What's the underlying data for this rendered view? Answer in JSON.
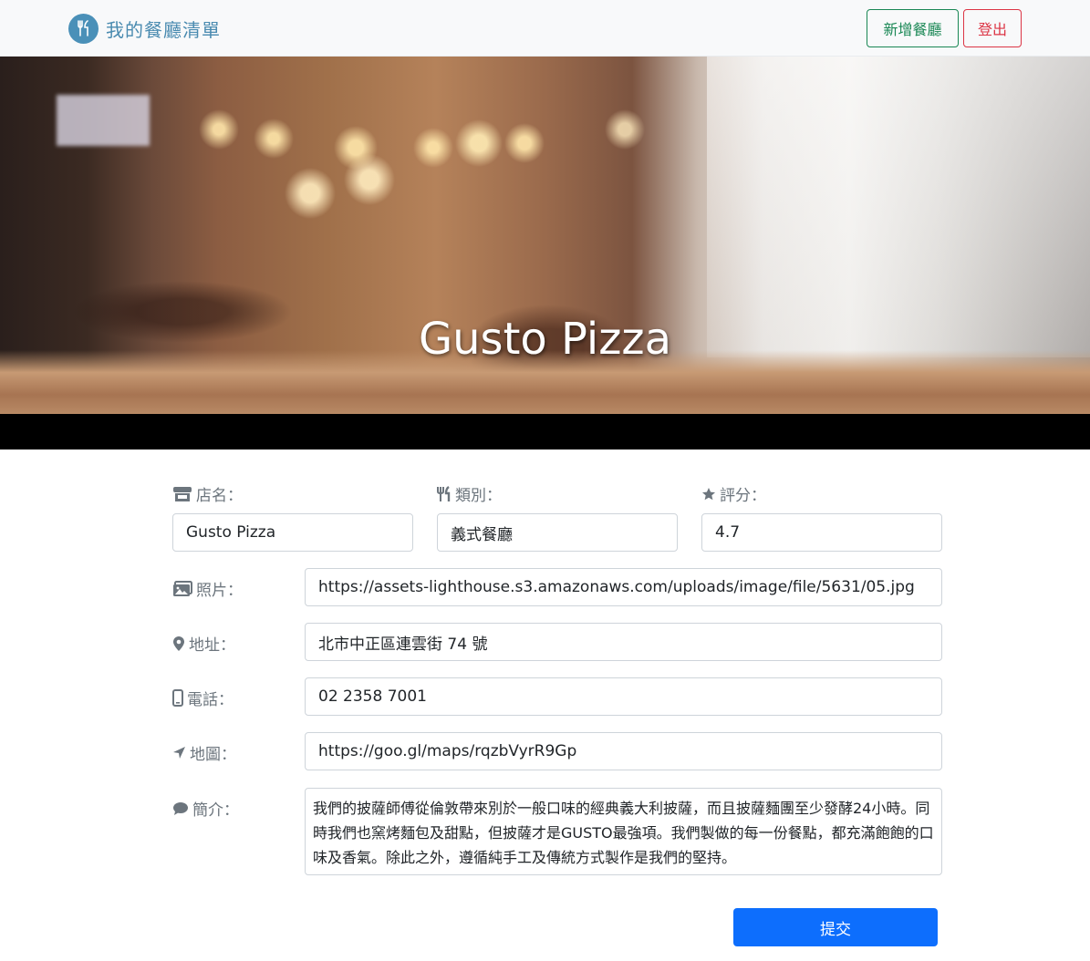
{
  "navbar": {
    "brand_title": "我的餐廳清單",
    "add_button": "新增餐廳",
    "logout_button": "登出"
  },
  "hero": {
    "title": "Gusto Pizza"
  },
  "form": {
    "name": {
      "label": "店名：",
      "value": "Gusto Pizza"
    },
    "category": {
      "label": "類別：",
      "value": "義式餐廳"
    },
    "rating": {
      "label": "評分：",
      "value": "4.7"
    },
    "image": {
      "label": "照片：",
      "value": "https://assets-lighthouse.s3.amazonaws.com/uploads/image/file/5631/05.jpg"
    },
    "location": {
      "label": "地址：",
      "value": "北市中正區連雲街 74 號"
    },
    "phone": {
      "label": "電話：",
      "value": "02 2358 7001"
    },
    "google_map": {
      "label": "地圖：",
      "value": "https://goo.gl/maps/rqzbVyrR9Gp"
    },
    "description": {
      "label": "簡介：",
      "value": "我們的披薩師傅從倫敦帶來別於一般口味的經典義大利披薩，而且披薩麵團至少發酵24小時。同時我們也窯烤麵包及甜點，但披薩才是GUSTO最強項。我們製做的每一份餐點，都充滿飽飽的口味及香氣。除此之外，遵循純手工及傳統方式製作是我們的堅持。"
    },
    "submit": "提交"
  },
  "colors": {
    "brand": "#4a8bb0",
    "success": "#198754",
    "danger": "#dc3545",
    "primary": "#0d6efd"
  },
  "icons": {
    "brand": "utensils-icon",
    "name": "store-icon",
    "category": "utensils-icon",
    "rating": "star-icon",
    "image": "images-icon",
    "location": "map-marker-icon",
    "phone": "mobile-icon",
    "google_map": "location-arrow-icon",
    "description": "comment-icon"
  }
}
